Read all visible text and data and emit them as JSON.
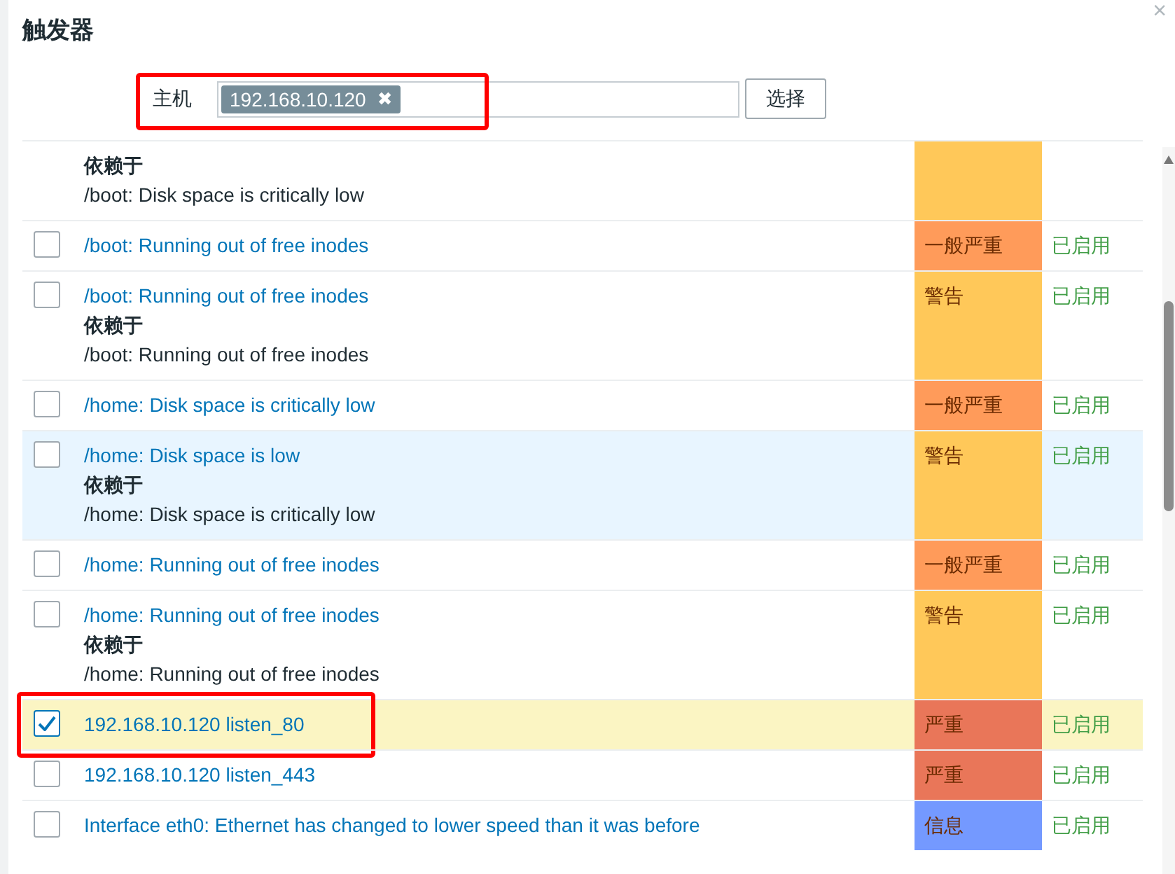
{
  "dialog": {
    "title": "触发器",
    "close": "×"
  },
  "host_filter": {
    "label": "主机",
    "annotated": true,
    "tags": [
      {
        "text": "192.168.10.120",
        "remove": "✖"
      }
    ],
    "button": "选择"
  },
  "rows": [
    {
      "kind": "continued",
      "hovered": false,
      "annotated": false,
      "depends_label": "依赖于",
      "depends": "/boot: Disk space is critically low",
      "severity": "",
      "color": "#ffc859",
      "status": ""
    },
    {
      "kind": "trigger",
      "checked": false,
      "hovered": false,
      "annotated": false,
      "name": "/boot: Running out of free inodes",
      "severity": "一般严重",
      "color": "#ff9b5a",
      "status": "已启用"
    },
    {
      "kind": "trigger",
      "checked": false,
      "hovered": false,
      "annotated": false,
      "name": "/boot: Running out of free inodes",
      "depends_label": "依赖于",
      "depends": "/boot: Running out of free inodes",
      "severity": "警告",
      "color": "#ffc859",
      "status": "已启用"
    },
    {
      "kind": "trigger",
      "checked": false,
      "hovered": false,
      "annotated": false,
      "name": "/home: Disk space is critically low",
      "severity": "一般严重",
      "color": "#ff9b5a",
      "status": "已启用"
    },
    {
      "kind": "trigger",
      "checked": false,
      "hovered": true,
      "annotated": false,
      "name": "/home: Disk space is low",
      "depends_label": "依赖于",
      "depends": "/home: Disk space is critically low",
      "severity": "警告",
      "color": "#ffc859",
      "status": "已启用"
    },
    {
      "kind": "trigger",
      "checked": false,
      "hovered": false,
      "annotated": false,
      "name": "/home: Running out of free inodes",
      "severity": "一般严重",
      "color": "#ff9b5a",
      "status": "已启用"
    },
    {
      "kind": "trigger",
      "checked": false,
      "hovered": false,
      "annotated": false,
      "name": "/home: Running out of free inodes",
      "depends_label": "依赖于",
      "depends": "/home: Running out of free inodes",
      "severity": "警告",
      "color": "#ffc859",
      "status": "已启用"
    },
    {
      "kind": "trigger",
      "checked": true,
      "hovered": false,
      "annotated": true,
      "name": "192.168.10.120 listen_80",
      "severity": "严重",
      "color": "#e97659",
      "status": "已启用"
    },
    {
      "kind": "trigger",
      "checked": false,
      "hovered": false,
      "annotated": false,
      "name": "192.168.10.120 listen_443",
      "severity": "严重",
      "color": "#e97659",
      "status": "已启用"
    },
    {
      "kind": "trigger",
      "checked": false,
      "hovered": false,
      "annotated": false,
      "name": "Interface eth0: Ethernet has changed to lower speed than it was before",
      "severity": "信息",
      "color": "#7499ff",
      "status": "已启用"
    }
  ]
}
